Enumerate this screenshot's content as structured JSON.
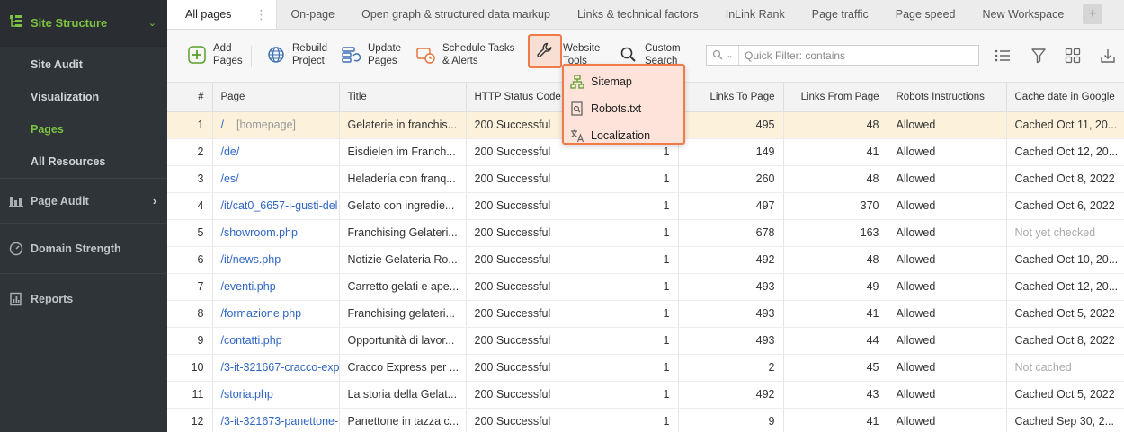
{
  "sidebar": {
    "header": "Site Structure",
    "sub_items": [
      {
        "label": "Site Audit",
        "active": false
      },
      {
        "label": "Visualization",
        "active": false
      },
      {
        "label": "Pages",
        "active": true
      },
      {
        "label": "All Resources",
        "active": false
      }
    ],
    "sections": [
      {
        "label": "Page Audit"
      },
      {
        "label": "Domain Strength"
      },
      {
        "label": "Reports"
      }
    ]
  },
  "tabs": [
    {
      "label": "All pages",
      "active": true
    },
    {
      "label": "On-page"
    },
    {
      "label": "Open graph & structured data markup"
    },
    {
      "label": "Links & technical factors"
    },
    {
      "label": "InLink Rank"
    },
    {
      "label": "Page traffic"
    },
    {
      "label": "Page speed"
    },
    {
      "label": "New Workspace"
    }
  ],
  "toolbar": {
    "add_pages": [
      "Add",
      "Pages"
    ],
    "rebuild": [
      "Rebuild",
      "Project"
    ],
    "update": [
      "Update",
      "Pages"
    ],
    "schedule": [
      "Schedule Tasks",
      "& Alerts"
    ],
    "website_tools": [
      "Website",
      "Tools"
    ],
    "custom_search": [
      "Custom",
      "Search"
    ],
    "filter_placeholder": "Quick Filter: contains"
  },
  "menu": {
    "items": [
      "Sitemap",
      "Robots.txt",
      "Localization"
    ]
  },
  "table": {
    "columns": [
      "#",
      "Page",
      "Title",
      "HTTP Status Code",
      "",
      "Links To Page",
      "Links From Page",
      "Robots Instructions",
      "Cache date in Google"
    ],
    "rows": [
      {
        "n": "1",
        "page": "/",
        "home": "[homepage]",
        "title": "Gelaterie in franchis...",
        "status": "200 Successful",
        "c5": "",
        "to": "495",
        "from": "48",
        "robots": "Allowed",
        "cache": "Cached Oct 11, 20...",
        "muted": false
      },
      {
        "n": "2",
        "page": "/de/",
        "home": "",
        "title": "Eisdielen im Franch...",
        "status": "200 Successful",
        "c5": "1",
        "to": "149",
        "from": "41",
        "robots": "Allowed",
        "cache": "Cached Oct 12, 20...",
        "muted": false
      },
      {
        "n": "3",
        "page": "/es/",
        "home": "",
        "title": "Heladería con franq...",
        "status": "200 Successful",
        "c5": "1",
        "to": "260",
        "from": "48",
        "robots": "Allowed",
        "cache": "Cached Oct 8, 2022",
        "muted": false
      },
      {
        "n": "4",
        "page": "/it/cat0_6657-i-gusti-del",
        "home": "",
        "title": "Gelato con ingredie...",
        "status": "200 Successful",
        "c5": "1",
        "to": "497",
        "from": "370",
        "robots": "Allowed",
        "cache": "Cached Oct 6, 2022",
        "muted": false
      },
      {
        "n": "5",
        "page": "/showroom.php",
        "home": "",
        "title": "Franchising Gelateri...",
        "status": "200 Successful",
        "c5": "1",
        "to": "678",
        "from": "163",
        "robots": "Allowed",
        "cache": "Not yet checked",
        "muted": true
      },
      {
        "n": "6",
        "page": "/it/news.php",
        "home": "",
        "title": "Notizie Gelateria Ro...",
        "status": "200 Successful",
        "c5": "1",
        "to": "492",
        "from": "48",
        "robots": "Allowed",
        "cache": "Cached Oct 10, 20...",
        "muted": false
      },
      {
        "n": "7",
        "page": "/eventi.php",
        "home": "",
        "title": "Carretto gelati e ape...",
        "status": "200 Successful",
        "c5": "1",
        "to": "493",
        "from": "49",
        "robots": "Allowed",
        "cache": "Cached Oct 12, 20...",
        "muted": false
      },
      {
        "n": "8",
        "page": "/formazione.php",
        "home": "",
        "title": "Franchising gelateri...",
        "status": "200 Successful",
        "c5": "1",
        "to": "493",
        "from": "41",
        "robots": "Allowed",
        "cache": "Cached Oct 5, 2022",
        "muted": false
      },
      {
        "n": "9",
        "page": "/contatti.php",
        "home": "",
        "title": "Opportunità di lavor...",
        "status": "200 Successful",
        "c5": "1",
        "to": "493",
        "from": "44",
        "robots": "Allowed",
        "cache": "Cached Oct 8, 2022",
        "muted": false
      },
      {
        "n": "10",
        "page": "/3-it-321667-cracco-exp",
        "home": "",
        "title": "Cracco Express per ...",
        "status": "200 Successful",
        "c5": "1",
        "to": "2",
        "from": "45",
        "robots": "Allowed",
        "cache": "Not cached",
        "muted": true
      },
      {
        "n": "11",
        "page": "/storia.php",
        "home": "",
        "title": "La storia della Gelat...",
        "status": "200 Successful",
        "c5": "1",
        "to": "492",
        "from": "43",
        "robots": "Allowed",
        "cache": "Cached Oct 5, 2022",
        "muted": false
      },
      {
        "n": "12",
        "page": "/3-it-321673-panettone-",
        "home": "",
        "title": "Panettone in tazza c...",
        "status": "200 Successful",
        "c5": "1",
        "to": "9",
        "from": "41",
        "robots": "Allowed",
        "cache": "Cached Sep 30, 2...",
        "muted": false
      }
    ]
  },
  "colors": {
    "sidebar_bg": "#2f3438",
    "accent_green": "#7cc142",
    "highlight_orange": "#f07a48",
    "menu_bg": "#fde3d9",
    "link_blue": "#2f66c4",
    "selected_row": "#fcf2dc"
  }
}
